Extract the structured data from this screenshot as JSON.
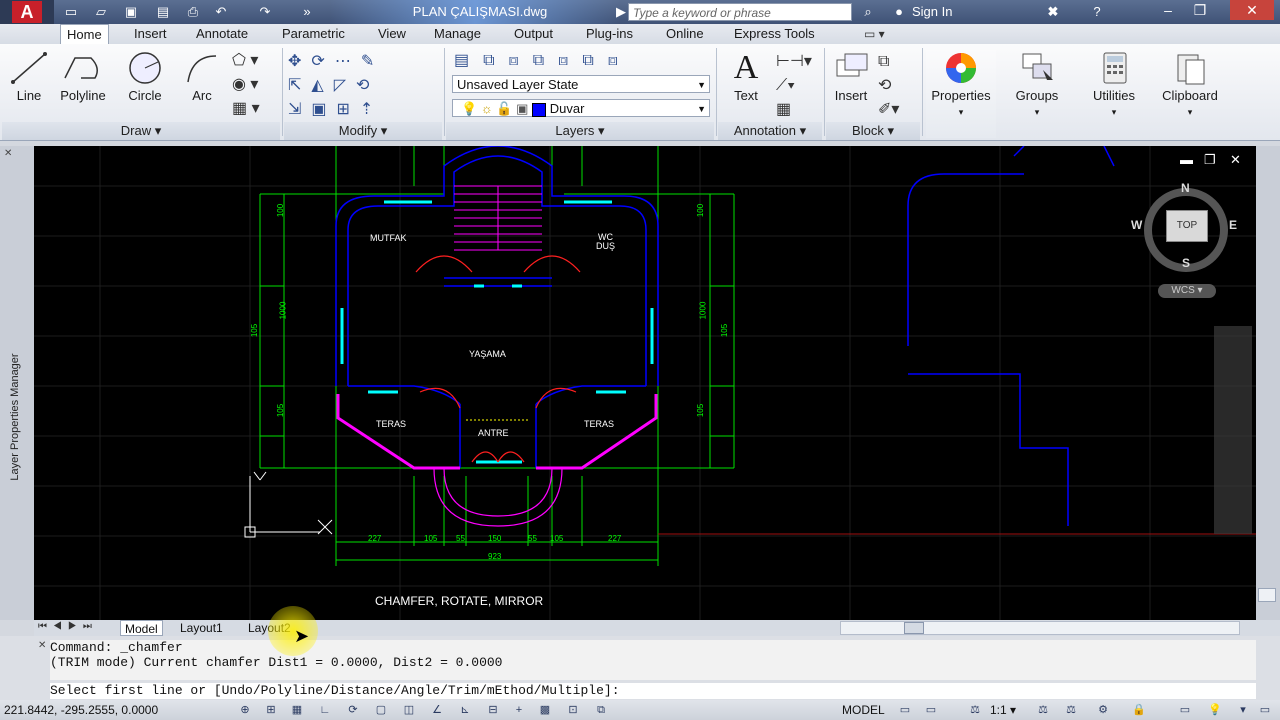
{
  "title_bar": {
    "document_title": "PLAN ÇALIŞMASI.dwg",
    "search_placeholder": "Type a keyword or phrase",
    "signin_label": "Sign In"
  },
  "ribbon_tabs": [
    "Home",
    "Insert",
    "Annotate",
    "Parametric",
    "View",
    "Manage",
    "Output",
    "Plug-ins",
    "Online",
    "Express Tools"
  ],
  "active_tab": "Home",
  "draw_panel": {
    "title": "Draw",
    "buttons": [
      "Line",
      "Polyline",
      "Circle",
      "Arc"
    ]
  },
  "modify_panel": {
    "title": "Modify"
  },
  "layers_panel": {
    "title": "Layers",
    "layer_state": "Unsaved Layer State",
    "current_layer": "Duvar",
    "layer_color": "#0000ff"
  },
  "annotation_panel": {
    "title": "Annotation",
    "text_label": "Text"
  },
  "block_panel": {
    "title": "Block",
    "insert_label": "Insert"
  },
  "right_buttons": [
    "Properties",
    "Groups",
    "Utilities",
    "Clipboard"
  ],
  "side_palette_label": "Layer Properties Manager",
  "viewcube": {
    "top": "TOP",
    "north": "N",
    "south": "S",
    "east": "E",
    "west": "W",
    "wcs": "WCS"
  },
  "drawing_labels": {
    "mutfak": "MUTFAK",
    "wc": "WC",
    "dus": "DUŞ",
    "yasama": "YAŞAMA",
    "teras_left": "TERAS",
    "teras_right": "TERAS",
    "antre": "ANTRE",
    "caption": "CHAMFER, ROTATE, MIRROR",
    "dims_bottom": [
      "227",
      "105",
      "55",
      "150",
      "55",
      "105",
      "227"
    ],
    "dim_total": "923",
    "dims_left": [
      "100",
      "100",
      "1000",
      "105",
      "105"
    ],
    "dims_right": [
      "100",
      "100",
      "1000",
      "105",
      "105"
    ]
  },
  "layout_tabs": [
    "Model",
    "Layout1",
    "Layout2"
  ],
  "command": {
    "line1": "Command: _chamfer",
    "line2": "(TRIM mode) Current chamfer Dist1 = 0.0000, Dist2 = 0.0000",
    "prompt": "Select first line or [Undo/Polyline/Distance/Angle/Trim/mEthod/Multiple]:"
  },
  "status": {
    "coords": "221.8442, -295.2555, 0.0000",
    "model": "MODEL",
    "scale": "1:1"
  },
  "colors": {
    "canvas": "#000000",
    "wall": "#0000ff",
    "dimension": "#00ff00",
    "stair": "#ff00ff",
    "window": "#00ffff",
    "door": "#ff0000"
  }
}
